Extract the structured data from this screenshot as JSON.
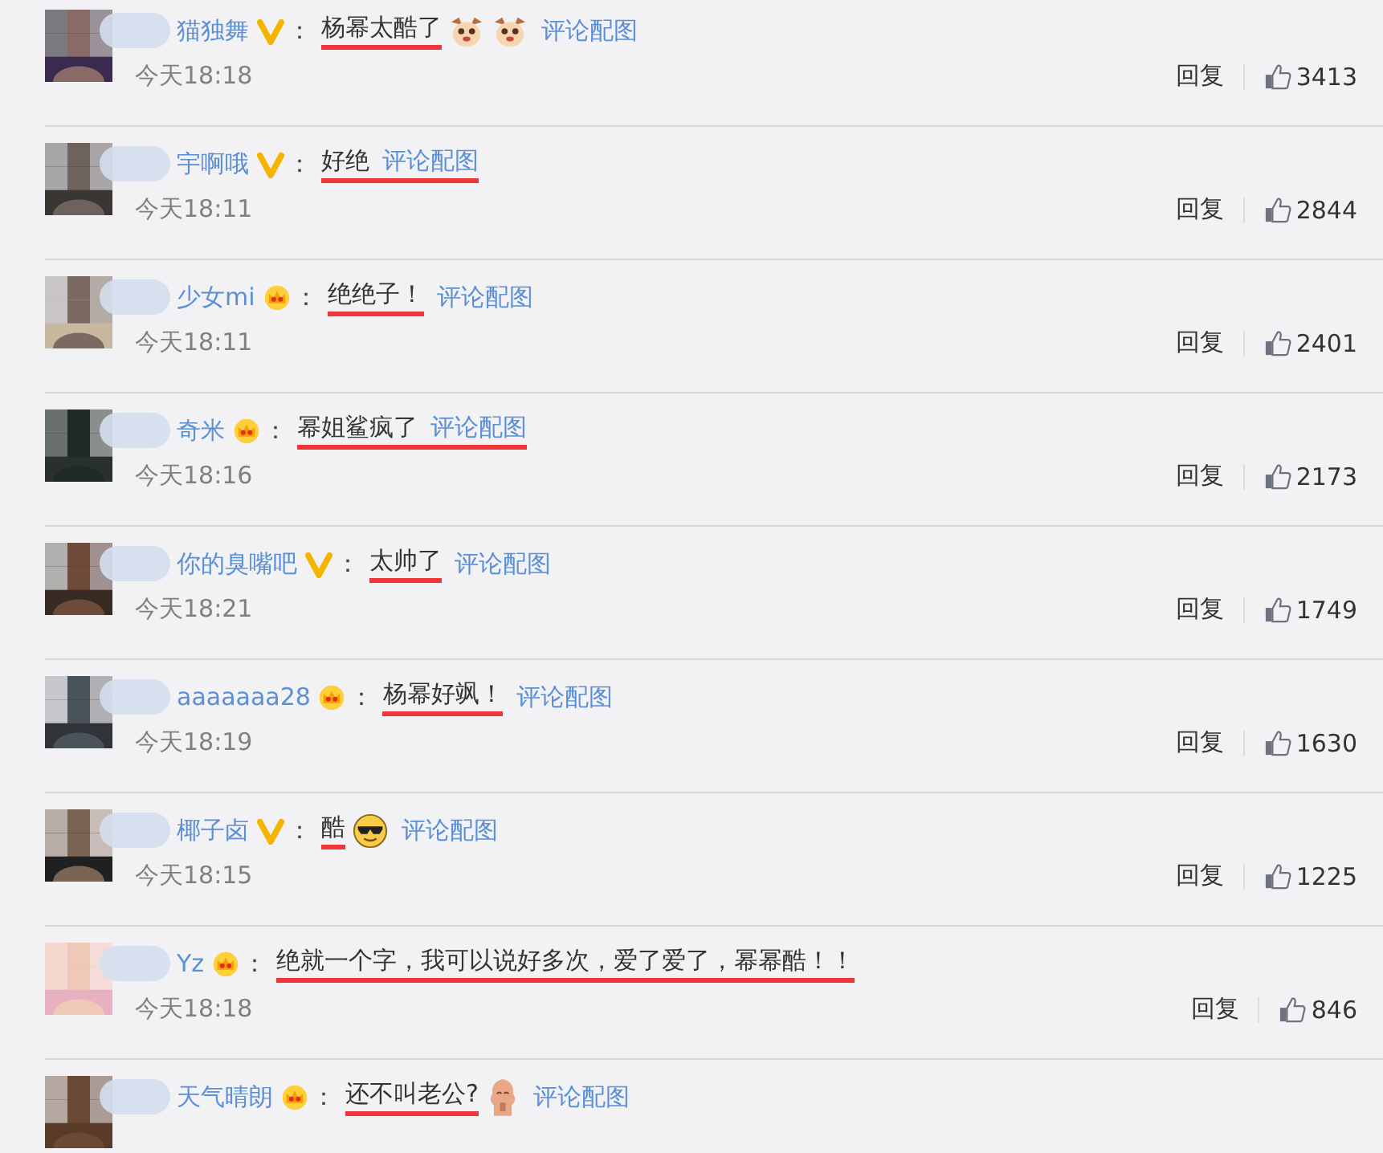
{
  "comments": [
    {
      "user": "猫独舞",
      "verified": true,
      "colon": "：",
      "text": "杨幂太酷了",
      "underlined": true,
      "underline_covers_link": false,
      "emojis": [
        {
          "kind": "dog"
        },
        {
          "kind": "dog"
        }
      ],
      "link": "评论配图",
      "time": "今天18:18",
      "reply": "回复",
      "likes": "3413"
    },
    {
      "user": "宇啊哦",
      "verified": true,
      "colon": "：",
      "text": "好绝",
      "underlined": true,
      "underline_covers_link": true,
      "link": "评论配图",
      "time": "今天18:11",
      "reply": "回复",
      "likes": "2844"
    },
    {
      "user": "少女mi",
      "verified": false,
      "colon": "：",
      "text": "绝绝子！",
      "underlined": true,
      "underline_covers_link": false,
      "link": "评论配图",
      "time": "今天18:11",
      "reply": "回复",
      "likes": "2401"
    },
    {
      "user": "奇米",
      "verified": false,
      "colon": "：",
      "text": "幂姐鲨疯了",
      "underlined": true,
      "underline_covers_link": true,
      "link": "评论配图",
      "time": "今天18:16",
      "reply": "回复",
      "likes": "2173"
    },
    {
      "user": "你的臭嘴吧",
      "verified": true,
      "colon": "：",
      "text": "太帅了",
      "underlined": true,
      "underline_covers_link": false,
      "link": "评论配图",
      "time": "今天18:21",
      "reply": "回复",
      "likes": "1749"
    },
    {
      "user": "aaaaaaa28",
      "verified": false,
      "colon": "：",
      "text": "杨幂好飒！",
      "underlined": true,
      "underline_covers_link": false,
      "link": "评论配图",
      "time": "今天18:19",
      "reply": "回复",
      "likes": "1630"
    },
    {
      "user": "椰子卤",
      "verified": true,
      "colon": "：",
      "text": "酷",
      "underlined": true,
      "underline_covers_link": false,
      "emojis": [
        {
          "kind": "sunglasses"
        }
      ],
      "link": "评论配图",
      "time": "今天18:15",
      "reply": "回复",
      "likes": "1225"
    },
    {
      "user": "Yz",
      "verified": false,
      "colon": "：",
      "text": "绝就一个字，我可以说好多次，爱了爱了，幂幂酷！！",
      "underlined": true,
      "underline_covers_link": false,
      "time": "今天18:18",
      "reply": "回复",
      "likes": "846"
    },
    {
      "user": "天气晴朗",
      "verified": false,
      "colon": "：",
      "text": "还不叫老公?",
      "underlined": true,
      "underline_covers_link": false,
      "emojis": [
        {
          "kind": "figure"
        }
      ],
      "link": "评论配图"
    }
  ]
}
